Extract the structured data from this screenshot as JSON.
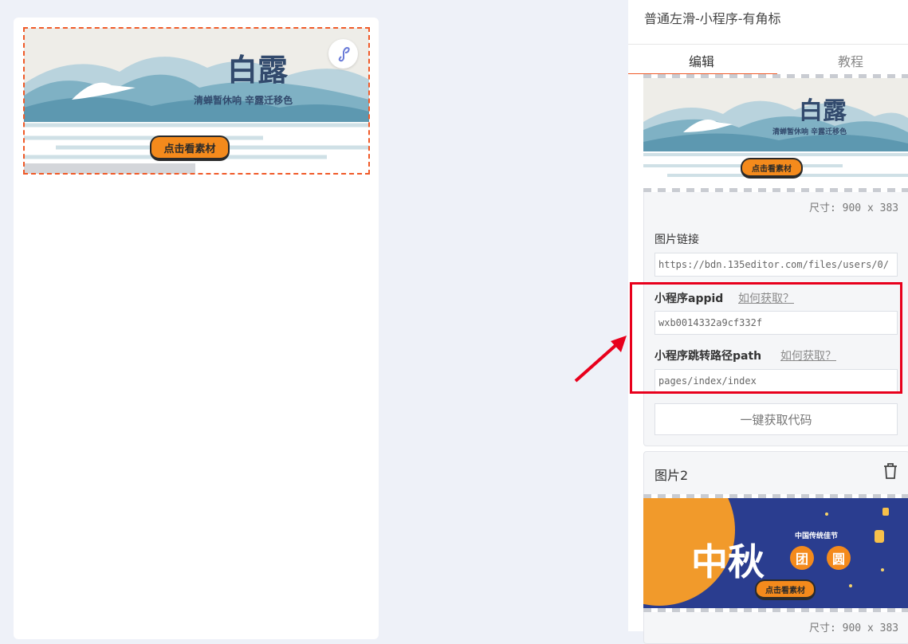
{
  "preview": {
    "banner": {
      "title": "白露",
      "subtitle": "清蝉暂休响  辛露迁移色",
      "button_label": "点击看素材"
    }
  },
  "panel": {
    "title": "普通左滑-小程序-有角标",
    "tabs": [
      {
        "label": "编辑",
        "active": true
      },
      {
        "label": "教程",
        "active": false
      }
    ],
    "image1": {
      "thumb_title": "白露",
      "thumb_subtitle": "清蝉暂休响  辛露迁移色",
      "thumb_button": "点击看素材",
      "size_label": "尺寸: 900 x 383",
      "link_label": "图片链接",
      "link_value": "https://bdn.135editor.com/files/users/0/",
      "appid_label": "小程序appid",
      "appid_help": "如何获取？",
      "appid_value": "wxb0014332a9cf332f",
      "path_label": "小程序跳转路径path",
      "path_help": "如何获取？",
      "path_value": "pages/index/index",
      "get_code_button": "一键获取代码"
    },
    "image2": {
      "title": "图片2",
      "thumb_big": "中秋",
      "thumb_badge1": "团",
      "thumb_badge2": "圆",
      "thumb_small": "中国传统佳节",
      "thumb_button": "点击看素材",
      "size_label": "尺寸: 900 x 383"
    }
  },
  "colors": {
    "accent": "#f05a28",
    "highlight_box": "#e8001c",
    "banner_button": "#f48a1c",
    "banner_title": "#324a6d"
  }
}
